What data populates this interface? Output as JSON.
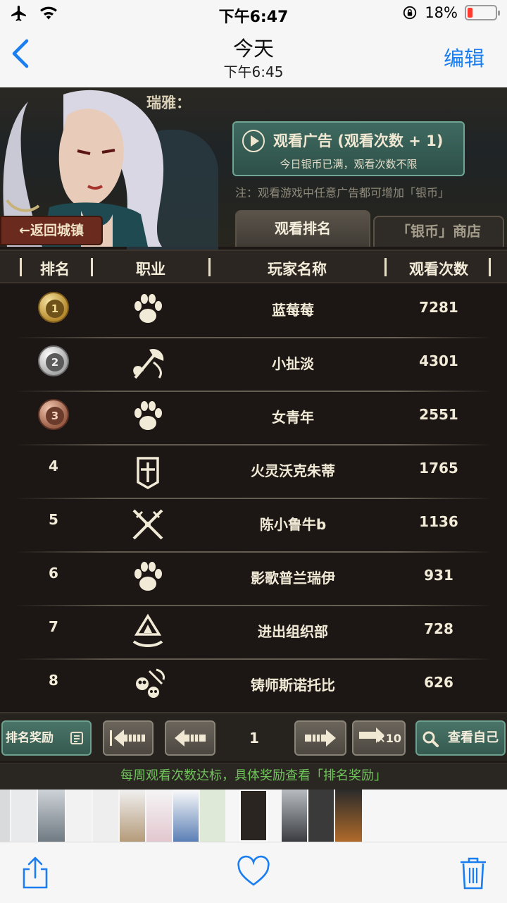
{
  "statusbar": {
    "time": "下午6:47",
    "battery_text": "18%",
    "battery_level": 0.18
  },
  "nav": {
    "back_glyph": "<",
    "title": "今天",
    "subtitle": "下午6:45",
    "edit_label": "编辑"
  },
  "game": {
    "speaker": "瑞雅：",
    "ad_button": {
      "title": "观看广告 (观看次数 + 1)",
      "subtitle": "今日银币已满，观看次数不限"
    },
    "note": "注：观看游戏中任意广告都可增加「银币」",
    "back_town": "←返回城镇",
    "tabs": [
      {
        "label": "观看排名",
        "active": true
      },
      {
        "label": "「银币」商店",
        "active": false
      }
    ],
    "columns": {
      "rank": "排名",
      "job": "职业",
      "player": "玩家名称",
      "views": "观看次数"
    },
    "rows": [
      {
        "rank": "1",
        "medal": "gold",
        "job_icon": "paw-icon",
        "name": "蓝莓莓",
        "views": "7281"
      },
      {
        "rank": "2",
        "medal": "silver",
        "job_icon": "axe-icon",
        "name": "小扯淡",
        "views": "4301"
      },
      {
        "rank": "3",
        "medal": "bronze",
        "job_icon": "paw-icon",
        "name": "女青年",
        "views": "2551"
      },
      {
        "rank": "4",
        "medal": "",
        "job_icon": "shield-icon",
        "name": "火灵沃克朱蒂",
        "views": "1765"
      },
      {
        "rank": "5",
        "medal": "",
        "job_icon": "crossed-daggers-icon",
        "name": "陈小鲁牛b",
        "views": "1136"
      },
      {
        "rank": "6",
        "medal": "",
        "job_icon": "paw-icon",
        "name": "影歌普兰瑞伊",
        "views": "931"
      },
      {
        "rank": "7",
        "medal": "",
        "job_icon": "arcane-sigil-icon",
        "name": "进出组织部",
        "views": "728"
      },
      {
        "rank": "8",
        "medal": "",
        "job_icon": "skull-pick-icon",
        "name": "铸师斯诺托比",
        "views": "626"
      }
    ],
    "controls": {
      "rewards": "排名奖励",
      "page": "1",
      "x10": "×10",
      "view_self": "查看自己"
    },
    "footer_note": "每周观看次数达标，具体奖励查看「排名奖励」"
  },
  "colors": {
    "ios_blue": "#1a7ef0",
    "accent_green": "#6fc25a",
    "battery_red": "#ff3b30"
  }
}
